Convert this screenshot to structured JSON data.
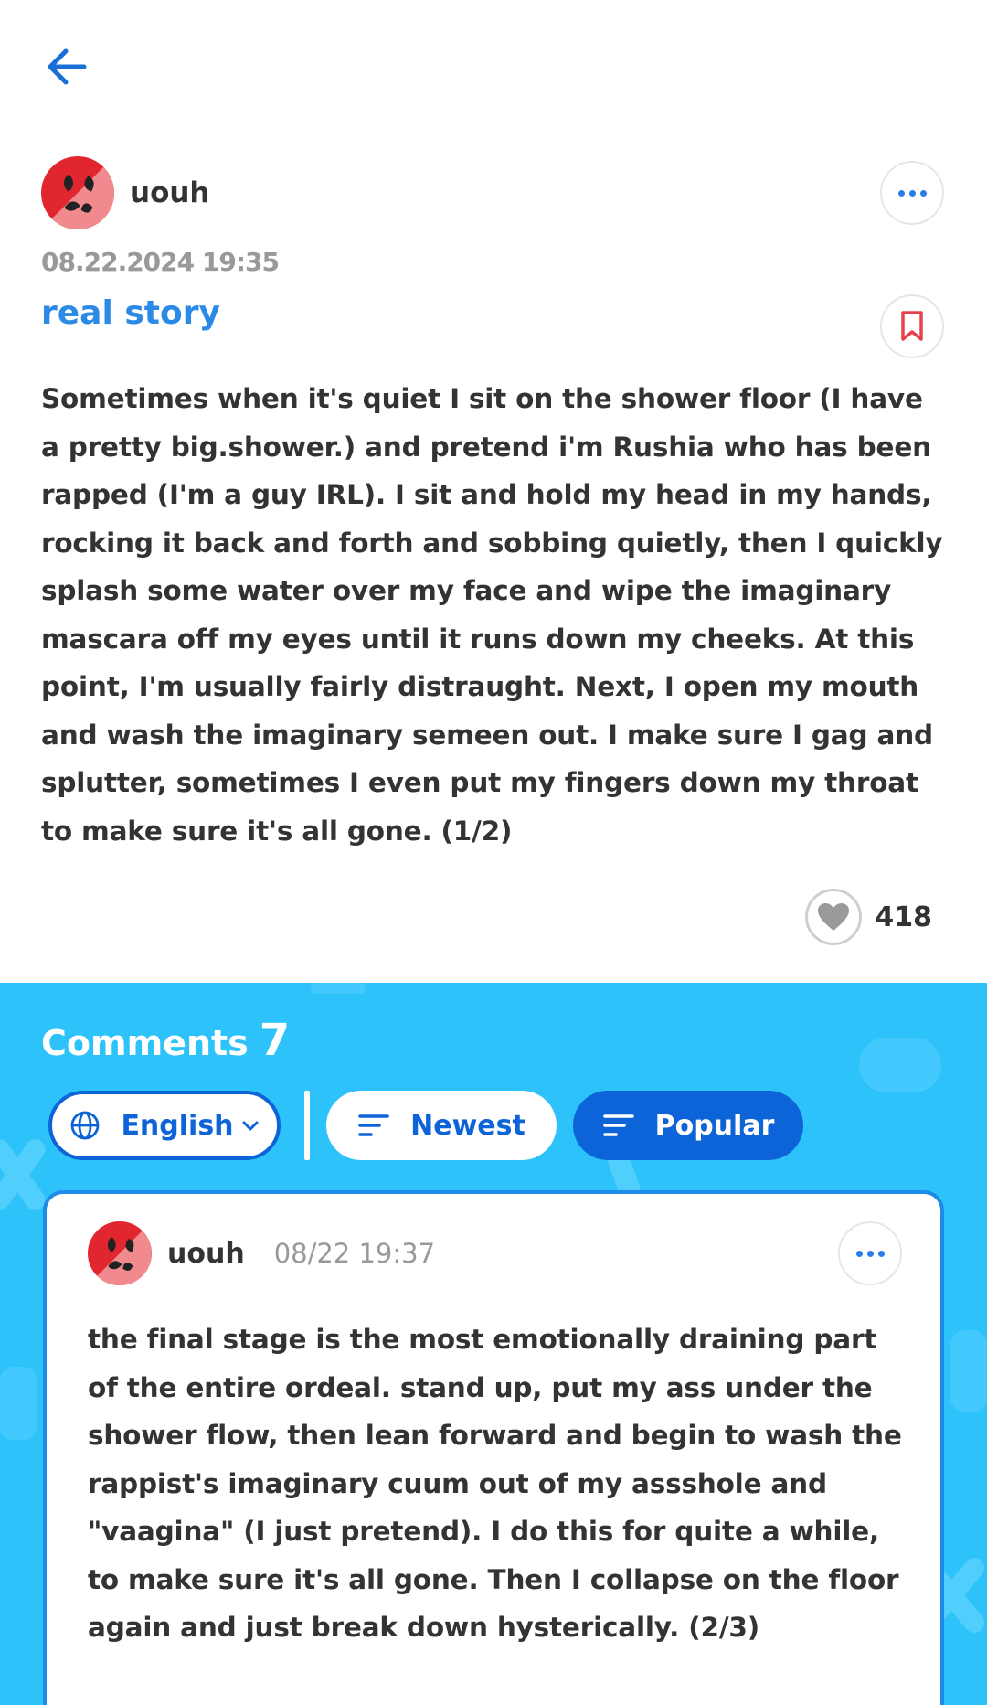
{
  "post": {
    "author": "uouh",
    "date": "08.22.2024 19:35",
    "title": "real story",
    "body": "Sometimes when it's quiet I sit on the shower floor (I have a pretty big.shower.) and pretend i'm Rushia who has been rapped (I'm a guy IRL). I sit and hold my head in my hands, rocking it back and forth and sobbing quietly, then I quickly splash some water over my face and wipe the imaginary mascara off my eyes until it runs down my cheeks. At this point, I'm usually fairly distraught. Next, I open my mouth and wash the imaginary semeen out. I make sure I gag and splutter, sometimes I even put my fingers down my throat to make sure it's all gone. (1/2)",
    "likes": "418"
  },
  "comments": {
    "label": "Comments",
    "count": "7",
    "language_filter": "English",
    "sort_newest": "Newest",
    "sort_popular": "Popular",
    "items": [
      {
        "author": "uouh",
        "date": "08/22 19:37",
        "body": "the final stage is the most emotionally draining part of the entire ordeal. stand up, put my ass under the shower flow, then lean forward and begin to wash the rappist's imaginary cuum out of my assshole and \"vaagina\" (I just pretend). I do this for quite a while, to make sure it's all gone. Then I collapse on the floor again and just break down hysterically. (2/3)"
      }
    ]
  },
  "icons": {
    "back": "arrow-left-icon",
    "more": "more-horizontal-icon",
    "bookmark": "bookmark-icon",
    "like": "heart-icon",
    "globe": "globe-icon",
    "chevron": "chevron-down-icon",
    "sort": "sort-lines-icon"
  },
  "colors": {
    "accent_blue": "#0c64d8",
    "title_blue": "#2b8ae6",
    "comments_bg": "#2ec2fb",
    "bookmark_red": "#e8414b",
    "avatar_red": "#e2262f"
  }
}
